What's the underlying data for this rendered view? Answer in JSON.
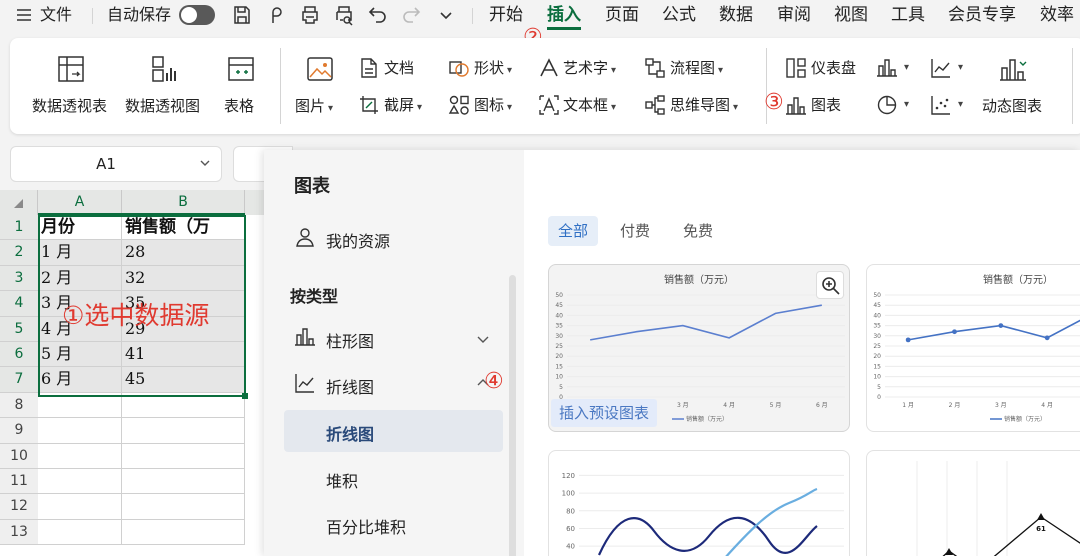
{
  "menu": {
    "file": "文件",
    "autosave": "自动保存",
    "tabs": [
      "开始",
      "插入",
      "页面",
      "公式",
      "数据",
      "审阅",
      "视图",
      "工具",
      "会员专享",
      "效率"
    ],
    "active_tab": "插入"
  },
  "ribbon": {
    "pivot_table": "数据透视表",
    "pivot_chart": "数据透视图",
    "table": "表格",
    "picture": "图片",
    "screenshot": "截屏",
    "document": "文档",
    "shape": "形状",
    "icons": "图标",
    "wordart": "艺术字",
    "textbox": "文本框",
    "flowchart": "流程图",
    "mindmap": "思维导图",
    "dashboard": "仪表盘",
    "chart": "图表",
    "dynamic_chart": "动态图表"
  },
  "namebox": {
    "value": "A1"
  },
  "sheet": {
    "columns": [
      "A",
      "B"
    ],
    "row_numbers": [
      "1",
      "2",
      "3",
      "4",
      "5",
      "6",
      "7",
      "8",
      "9",
      "10",
      "11",
      "12",
      "13"
    ],
    "rows": [
      [
        "月份",
        "销售额（万"
      ],
      [
        "1 月",
        "28"
      ],
      [
        "2 月",
        "32"
      ],
      [
        "3 月",
        "35"
      ],
      [
        "4 月",
        "29"
      ],
      [
        "5 月",
        "41"
      ],
      [
        "6 月",
        "45"
      ]
    ],
    "annotation": "①选中数据源"
  },
  "markers": {
    "m2": "②",
    "m3": "③",
    "m4": "④"
  },
  "panel": {
    "title": "图表",
    "my_resources": "我的资源",
    "by_type": "按类型",
    "types": {
      "bar": "柱形图",
      "line": "折线图",
      "line_sub": "折线图",
      "stacked": "堆积",
      "percent_stacked": "百分比堆积"
    },
    "filters": [
      "全部",
      "付费",
      "免费"
    ],
    "insert_preset": "插入预设图表"
  },
  "chart_data": [
    {
      "type": "line",
      "title": "销售额（万元）",
      "categories": [
        "1 月",
        "2 月",
        "3 月",
        "4 月",
        "5 月",
        "6 月"
      ],
      "x_tick_labels": [
        "3 月",
        "4 月",
        "5 月",
        "6 月"
      ],
      "series": [
        {
          "name": "销售额（万元）",
          "values": [
            28,
            32,
            35,
            29,
            41,
            45
          ]
        }
      ],
      "ylim": [
        0,
        50
      ],
      "yticks": [
        "50",
        "45",
        "40",
        "35",
        "30",
        "25",
        "20",
        "15",
        "10",
        "5",
        "0"
      ],
      "color": "#5b7fcf",
      "markers": false
    },
    {
      "type": "line",
      "title": "销售额（万元）",
      "categories": [
        "1 月",
        "2 月",
        "3 月",
        "4 月",
        "5 月",
        "6 月"
      ],
      "x_tick_labels": [
        "1 月",
        "2 月",
        "3 月",
        "4 月"
      ],
      "series": [
        {
          "name": "销售额（万元）",
          "values": [
            28,
            32,
            35,
            29,
            41,
            45
          ]
        }
      ],
      "ylim": [
        0,
        50
      ],
      "yticks": [
        "50",
        "45",
        "40",
        "35",
        "30",
        "25",
        "20",
        "15",
        "10",
        "5",
        "0"
      ],
      "color": "#4472c4",
      "markers": true
    },
    {
      "type": "line",
      "yticks": [
        "120",
        "100",
        "80",
        "60",
        "40"
      ],
      "ylim": [
        30,
        125
      ]
    },
    {
      "type": "line",
      "data_labels": [
        "61"
      ]
    }
  ]
}
